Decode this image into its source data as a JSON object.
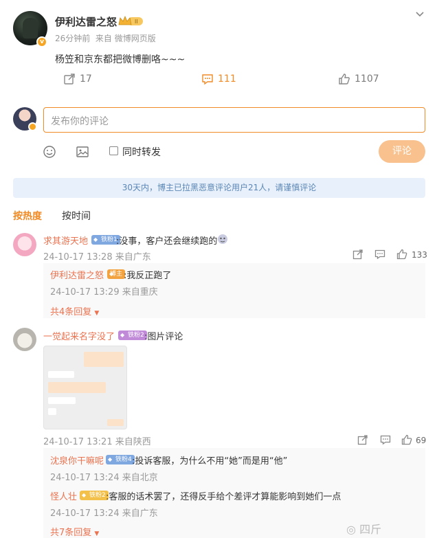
{
  "post": {
    "author": "伊利达雷之怒",
    "verified_badge": "v",
    "time": "26分钟前",
    "source": "来自 微博网页版",
    "text": "杨笠和京东都把微博删咯~~~",
    "reposts": "17",
    "comments": "111",
    "likes": "1107",
    "comments_color": "#f08a24"
  },
  "composer": {
    "placeholder": "发布你的评论",
    "repost_label": "同时转发",
    "submit_label": "评论"
  },
  "notice": "30天内，博主已拉黑恶意评论用户21人，请谨慎评论",
  "sort": {
    "hot": "按热度",
    "time": "按时间"
  },
  "comments": [
    {
      "name": "求其游天地",
      "badge": "铁粉1",
      "text": ":没事，客户还会继续跑的",
      "time": "24-10-17 13:28 来自广东",
      "likes": "133",
      "replies": [
        {
          "name": "伊利达雷之怒",
          "badge": "博主",
          "text": ":我反正跑了",
          "time": "24-10-17 13:29 来自重庆"
        }
      ],
      "more": "共4条回复"
    },
    {
      "name": "一觉起来名字没了",
      "badge": "铁粉2",
      "text": ":图片评论",
      "time": "24-10-17 13:21 来自陕西",
      "likes": "69",
      "replies": [
        {
          "name": "沈泉你干嘛呢",
          "badge": "铁粉4",
          "text": ":投诉客服，为什么不用“她”而是用“他”",
          "time": "24-10-17 13:24 来自北京"
        },
        {
          "name": "怪人壮",
          "badge": "铁粉2",
          "text": ":客服的话术罢了，还得反手给个差评才算能影响到她们一点",
          "time": "24-10-17 13:24 来自广东"
        }
      ],
      "more": "共7条回复"
    }
  ],
  "watermark": "四斤"
}
